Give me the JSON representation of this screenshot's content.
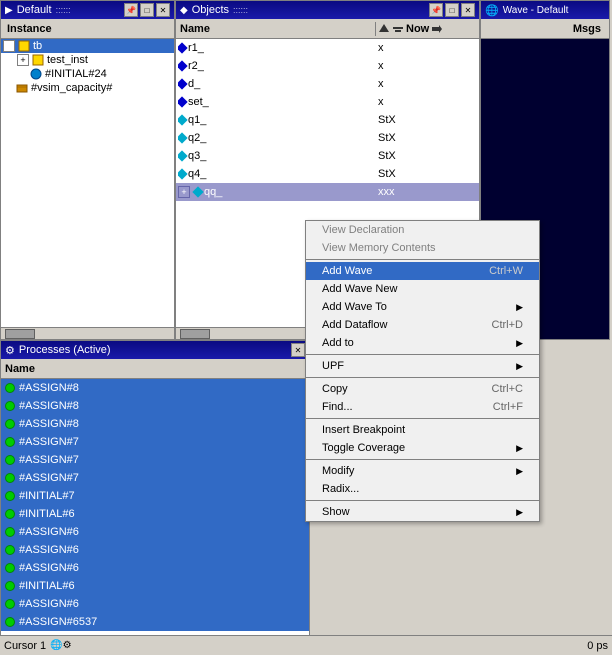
{
  "panels": {
    "instance": {
      "title": "Default",
      "col_label": "Instance",
      "tree": [
        {
          "id": "tb",
          "label": "tb",
          "type": "module",
          "level": 0,
          "expanded": true,
          "has_children": true
        },
        {
          "id": "test_inst",
          "label": "test_inst",
          "type": "module",
          "level": 1,
          "expanded": false,
          "has_children": true
        },
        {
          "id": "initial24",
          "label": "#INITIAL#24",
          "type": "process",
          "level": 1,
          "expanded": false,
          "has_children": false
        },
        {
          "id": "vsim_capacity",
          "label": "#vsim_capacity#",
          "type": "special",
          "level": 0,
          "expanded": false,
          "has_children": false
        }
      ]
    },
    "objects": {
      "title": "Objects",
      "columns": [
        "Name",
        "Now"
      ],
      "rows": [
        {
          "name": "r1_",
          "value": "x",
          "type": "blue"
        },
        {
          "name": "r2_",
          "value": "x",
          "type": "blue"
        },
        {
          "name": "d_",
          "value": "x",
          "type": "blue"
        },
        {
          "name": "set_",
          "value": "x",
          "type": "blue"
        },
        {
          "name": "q1_",
          "value": "StX",
          "type": "teal"
        },
        {
          "name": "q2_",
          "value": "StX",
          "type": "teal"
        },
        {
          "name": "q3_",
          "value": "StX",
          "type": "teal"
        },
        {
          "name": "q4_",
          "value": "StX",
          "type": "teal"
        },
        {
          "name": "qq_",
          "value": "xxx",
          "type": "teal",
          "expanded": true
        }
      ]
    },
    "wave": {
      "title": "Wave - Default",
      "col_msgs": "Msgs"
    },
    "processes": {
      "title": "Processes (Active)",
      "col_label": "Name",
      "rows": [
        "#ASSIGN#8",
        "#ASSIGN#8",
        "#ASSIGN#8",
        "#ASSIGN#7",
        "#ASSIGN#7",
        "#ASSIGN#7",
        "#INITIAL#7",
        "#INITIAL#6",
        "#ASSIGN#6",
        "#ASSIGN#6",
        "#ASSIGN#6",
        "#INITIAL#6",
        "#ASSIGN#6",
        "#ASSIGN#6537"
      ]
    }
  },
  "context_menu": {
    "items": [
      {
        "label": "View Declaration",
        "shortcut": "",
        "enabled": true,
        "highlighted": false,
        "has_submenu": false
      },
      {
        "label": "View Memory Contents",
        "shortcut": "",
        "enabled": true,
        "highlighted": false,
        "has_submenu": false
      },
      {
        "separator_after": true
      },
      {
        "label": "Add Wave",
        "shortcut": "Ctrl+W",
        "enabled": true,
        "highlighted": true,
        "has_submenu": false
      },
      {
        "label": "Add Wave New",
        "shortcut": "",
        "enabled": true,
        "highlighted": false,
        "has_submenu": false
      },
      {
        "label": "Add Wave To",
        "shortcut": "",
        "enabled": true,
        "highlighted": false,
        "has_submenu": true
      },
      {
        "label": "Add Dataflow",
        "shortcut": "Ctrl+D",
        "enabled": true,
        "highlighted": false,
        "has_submenu": false
      },
      {
        "label": "Add to",
        "shortcut": "",
        "enabled": true,
        "highlighted": false,
        "has_submenu": true
      },
      {
        "separator_after": true
      },
      {
        "label": "UPF",
        "shortcut": "",
        "enabled": true,
        "highlighted": false,
        "has_submenu": true
      },
      {
        "separator_after": true
      },
      {
        "label": "Copy",
        "shortcut": "Ctrl+C",
        "enabled": true,
        "highlighted": false,
        "has_submenu": false
      },
      {
        "label": "Find...",
        "shortcut": "Ctrl+F",
        "enabled": true,
        "highlighted": false,
        "has_submenu": false
      },
      {
        "separator_after": true
      },
      {
        "label": "Insert Breakpoint",
        "shortcut": "",
        "enabled": true,
        "highlighted": false,
        "has_submenu": false
      },
      {
        "label": "Toggle Coverage",
        "shortcut": "",
        "enabled": true,
        "highlighted": false,
        "has_submenu": true
      },
      {
        "separator_after": true
      },
      {
        "label": "Modify",
        "shortcut": "",
        "enabled": true,
        "highlighted": false,
        "has_submenu": true
      },
      {
        "label": "Radix...",
        "shortcut": "",
        "enabled": true,
        "highlighted": false,
        "has_submenu": false
      },
      {
        "separator_after": true
      },
      {
        "label": "Show",
        "shortcut": "",
        "enabled": true,
        "highlighted": false,
        "has_submenu": true
      }
    ]
  },
  "statusbar": {
    "cursor_label": "Cursor 1",
    "time_value": "0 ps"
  }
}
